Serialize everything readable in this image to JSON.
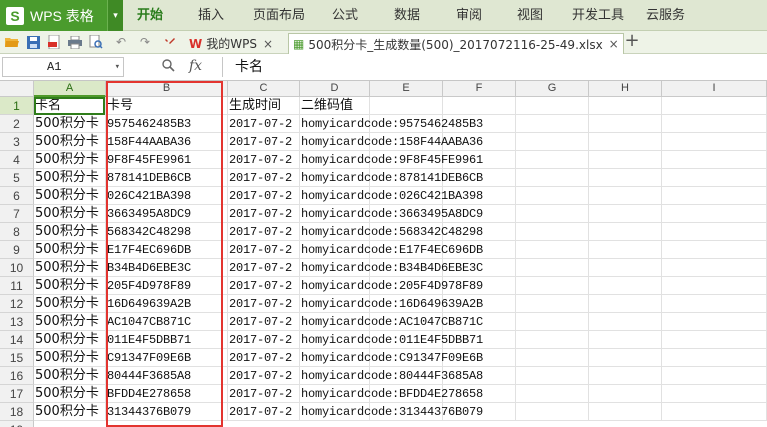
{
  "app": {
    "logo": "S",
    "name": "WPS 表格",
    "dropdown": "▾"
  },
  "menus": [
    "开始",
    "插入",
    "页面布局",
    "公式",
    "数据",
    "审阅",
    "视图",
    "开发工具",
    "云服务"
  ],
  "active_menu": "开始",
  "tabs": [
    {
      "label": "我的WPS",
      "close": "×",
      "icon": "W"
    },
    {
      "label": "500积分卡_生成数量(500)_2017072116-25-49.xlsx",
      "close": "×",
      "icon": "▦"
    }
  ],
  "new_tab": "+",
  "name_box": {
    "value": "A1",
    "arrow": "▾"
  },
  "fx_label": "fx",
  "formula_value": "卡名",
  "columns": [
    "A",
    "B",
    "C",
    "D",
    "E",
    "F",
    "G",
    "H",
    "I"
  ],
  "selected_column": "A",
  "headers": {
    "a": "卡名",
    "b": "卡号",
    "c": "生成时间",
    "d": "二维码值"
  },
  "rows": [
    {
      "n": "2",
      "a": "500积分卡",
      "b": "9575462485B3",
      "c": "2017-07-2",
      "d": "homyicardcode:9575462485B3"
    },
    {
      "n": "3",
      "a": "500积分卡",
      "b": "158F44AABA36",
      "c": "2017-07-2",
      "d": "homyicardcode:158F44AABA36"
    },
    {
      "n": "4",
      "a": "500积分卡",
      "b": "9F8F45FE9961",
      "c": "2017-07-2",
      "d": "homyicardcode:9F8F45FE9961"
    },
    {
      "n": "5",
      "a": "500积分卡",
      "b": "878141DEB6CB",
      "c": "2017-07-2",
      "d": "homyicardcode:878141DEB6CB"
    },
    {
      "n": "6",
      "a": "500积分卡",
      "b": "026C421BA398",
      "c": "2017-07-2",
      "d": "homyicardcode:026C421BA398"
    },
    {
      "n": "7",
      "a": "500积分卡",
      "b": "3663495A8DC9",
      "c": "2017-07-2",
      "d": "homyicardcode:3663495A8DC9"
    },
    {
      "n": "8",
      "a": "500积分卡",
      "b": "568342C48298",
      "c": "2017-07-2",
      "d": "homyicardcode:568342C48298"
    },
    {
      "n": "9",
      "a": "500积分卡",
      "b": "E17F4EC696DB",
      "c": "2017-07-2",
      "d": "homyicardcode:E17F4EC696DB"
    },
    {
      "n": "10",
      "a": "500积分卡",
      "b": "B34B4D6EBE3C",
      "c": "2017-07-2",
      "d": "homyicardcode:B34B4D6EBE3C"
    },
    {
      "n": "11",
      "a": "500积分卡",
      "b": "205F4D978F89",
      "c": "2017-07-2",
      "d": "homyicardcode:205F4D978F89"
    },
    {
      "n": "12",
      "a": "500积分卡",
      "b": "16D649639A2B",
      "c": "2017-07-2",
      "d": "homyicardcode:16D649639A2B"
    },
    {
      "n": "13",
      "a": "500积分卡",
      "b": "AC1047CB871C",
      "c": "2017-07-2",
      "d": "homyicardcode:AC1047CB871C"
    },
    {
      "n": "14",
      "a": "500积分卡",
      "b": "011E4F5DBB71",
      "c": "2017-07-2",
      "d": "homyicardcode:011E4F5DBB71"
    },
    {
      "n": "15",
      "a": "500积分卡",
      "b": "C91347F09E6B",
      "c": "2017-07-2",
      "d": "homyicardcode:C91347F09E6B"
    },
    {
      "n": "16",
      "a": "500积分卡",
      "b": "80444F3685A8",
      "c": "2017-07-2",
      "d": "homyicardcode:80444F3685A8"
    },
    {
      "n": "17",
      "a": "500积分卡",
      "b": "BFDD4E278658",
      "c": "2017-07-2",
      "d": "homyicardcode:BFDD4E278658"
    },
    {
      "n": "18",
      "a": "500积分卡",
      "b": "31344376B079",
      "c": "2017-07-2",
      "d": "homyicardcode:31344376B079"
    }
  ],
  "colors": {
    "accent": "#4a9b2d",
    "highlight": "#e3342f"
  }
}
